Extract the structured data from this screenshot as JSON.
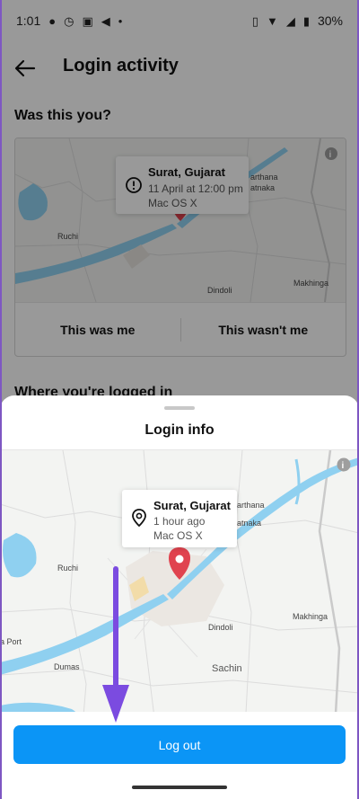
{
  "status_bar": {
    "time": "1:01",
    "battery": "30%"
  },
  "header": {
    "title": "Login activity"
  },
  "background": {
    "section_title": "Was this you?",
    "popup": {
      "location": "Surat, Gujarat",
      "time": "11 April at 12:00 pm",
      "device": "Mac OS X"
    },
    "map_labels": {
      "ruchi": "Ruchi",
      "dindoli": "Dindoli",
      "makhinga": "Makhinga",
      "partial_top": "arthana",
      "partial_bottom": "atnaka"
    },
    "this_was_me": "This was me",
    "this_wasnt_me": "This wasn't me",
    "section2_title": "Where you're logged in"
  },
  "sheet": {
    "title": "Login info",
    "popup": {
      "location": "Surat, Gujarat",
      "time": "1 hour ago",
      "device": "Mac OS X"
    },
    "map_labels": {
      "ruchi": "Ruchi",
      "dindoli": "Dindoli",
      "makhinga": "Makhinga",
      "sachin": "Sachin",
      "dumas": "Dumas",
      "port": "a Port",
      "partial_top": "arthana",
      "partial_bottom": "atnaka"
    },
    "logout_label": "Log out"
  },
  "colors": {
    "accent": "#0b95f6",
    "pin": "#e0434f",
    "water": "#8fd0f0",
    "annotation": "#7b4be0"
  },
  "icons": [
    "back-arrow-icon",
    "info-icon",
    "alert-circle-icon",
    "location-pin-icon",
    "map-marker-icon"
  ]
}
